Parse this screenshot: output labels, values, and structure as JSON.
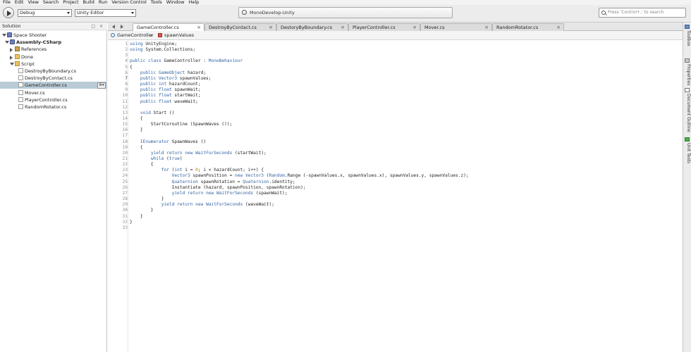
{
  "menu": [
    "File",
    "Edit",
    "View",
    "Search",
    "Project",
    "Build",
    "Run",
    "Version Control",
    "Tools",
    "Window",
    "Help"
  ],
  "toolbar": {
    "config": "Debug",
    "target": "Unity Editor",
    "status": "MonoDevelop-Unity",
    "search_placeholder": "Press 'Control+,' to search"
  },
  "solution": {
    "title": "Solution",
    "pad_buttons": "□ ×",
    "tree": [
      {
        "label": "Space Shooter",
        "icon": "solution-icon",
        "level": 0,
        "expander": "open"
      },
      {
        "label": "Assembly-CSharp",
        "icon": "csharp-project-icon",
        "level": 1,
        "expander": "open",
        "bold": true
      },
      {
        "label": "References",
        "icon": "references-icon",
        "level": 2,
        "expander": "closed"
      },
      {
        "label": "Done",
        "icon": "folder-icon",
        "level": 2,
        "expander": "closed"
      },
      {
        "label": "Script",
        "icon": "folder-icon",
        "level": 2,
        "expander": "open"
      },
      {
        "label": "DestroyByBoundary.cs",
        "icon": "cs-file-icon",
        "level": 3
      },
      {
        "label": "DestroyByContact.cs",
        "icon": "cs-file-icon",
        "level": 3
      },
      {
        "label": "GameController.cs",
        "icon": "cs-file-icon",
        "level": 3,
        "selected": true
      },
      {
        "label": "Mover.cs",
        "icon": "cs-file-icon",
        "level": 3
      },
      {
        "label": "PlayerController.cs",
        "icon": "cs-file-icon",
        "level": 3
      },
      {
        "label": "RandomRotator.cs",
        "icon": "cs-file-icon",
        "level": 3
      }
    ],
    "row_options": "⚙▾"
  },
  "tabs": [
    {
      "label": "GameController.cs",
      "active": true
    },
    {
      "label": "DestroyByContact.cs"
    },
    {
      "label": "DestoryByBoundary.cs"
    },
    {
      "label": "PlayerController.cs"
    },
    {
      "label": "Mover.cs"
    },
    {
      "label": "RandomRotator.cs"
    }
  ],
  "breadcrumb": {
    "class_name": "GameController",
    "member": "spawnValues"
  },
  "editor": {
    "current_line": 7,
    "lines": [
      "using UnityEngine;",
      "using System.Collections;",
      "",
      "public class GameController : MonoBehaviour",
      "{",
      "    public GameObject hazard;",
      "    public Vector3 spawnValues;",
      "    public int hazardCount;",
      "    public float spawnWait;",
      "    public float startWait;",
      "    public float waveWait;",
      "",
      "    void Start ()",
      "    {",
      "        StartCoroutine (SpawnWaves ());",
      "    }",
      "",
      "    IEnumerator SpawnWaves ()",
      "    {",
      "        yield return new WaitForSeconds (startWait);",
      "        while (true)",
      "        {",
      "            for (int i = 0; i < hazardCount; i++) {",
      "                Vector3 spawnPosition = new Vector3 (Random.Range (-spawnValues.x, spawnValues.x), spawnValues.y, spawnValues.z);",
      "                Quaternion spawnRotation = Quaternion.identity;",
      "                Instantiate (hazard, spawnPosition, spawnRotation);",
      "                yield return new WaitForSeconds (spawnWait);",
      "            }",
      "            yield return new WaitForSeconds (waveWait);",
      "        }",
      "    }",
      "}",
      ""
    ]
  },
  "right_dock": [
    "Toolbox",
    "Properties",
    "Document Outline",
    "Unit Tests"
  ],
  "colors": {
    "keyword": "#3364a4",
    "number": "#cc7a00",
    "selection": "#b9ccd6"
  }
}
